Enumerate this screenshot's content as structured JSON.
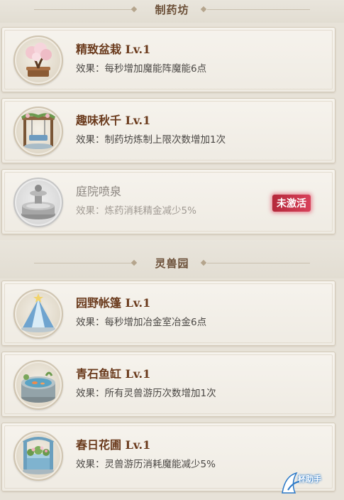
{
  "sections": [
    {
      "title": "制药坊",
      "cards": [
        {
          "name": "精致盆栽 Lv.1",
          "effect": "效果：每秒增加魔能阵魔能6点",
          "icon": "bonsai-icon",
          "active": true
        },
        {
          "name": "趣味秋千 Lv.1",
          "effect": "效果：制药坊炼制上限次数增加1次",
          "icon": "swing-icon",
          "active": true
        },
        {
          "name": "庭院喷泉",
          "effect": "效果：炼药消耗精金减少5%",
          "icon": "fountain-icon",
          "active": false,
          "badge": "未激活"
        }
      ]
    },
    {
      "title": "灵兽园",
      "cards": [
        {
          "name": "园野帐篷 Lv.1",
          "effect": "效果：每秒增加冶金室冶金6点",
          "icon": "tent-icon",
          "active": true
        },
        {
          "name": "青石鱼缸 Lv.1",
          "effect": "效果：所有灵兽游历次数增加1次",
          "icon": "fish-tank-icon",
          "active": true
        },
        {
          "name": "春日花圃 Lv.1",
          "effect": "效果：灵兽游历消耗魔能减少5%",
          "icon": "flower-bed-icon",
          "active": true
        }
      ]
    }
  ],
  "watermark": {
    "text": "杯助手"
  },
  "colors": {
    "title": "#6a3a1c",
    "badge": "#c62f47",
    "background": "#e7e2d8"
  }
}
